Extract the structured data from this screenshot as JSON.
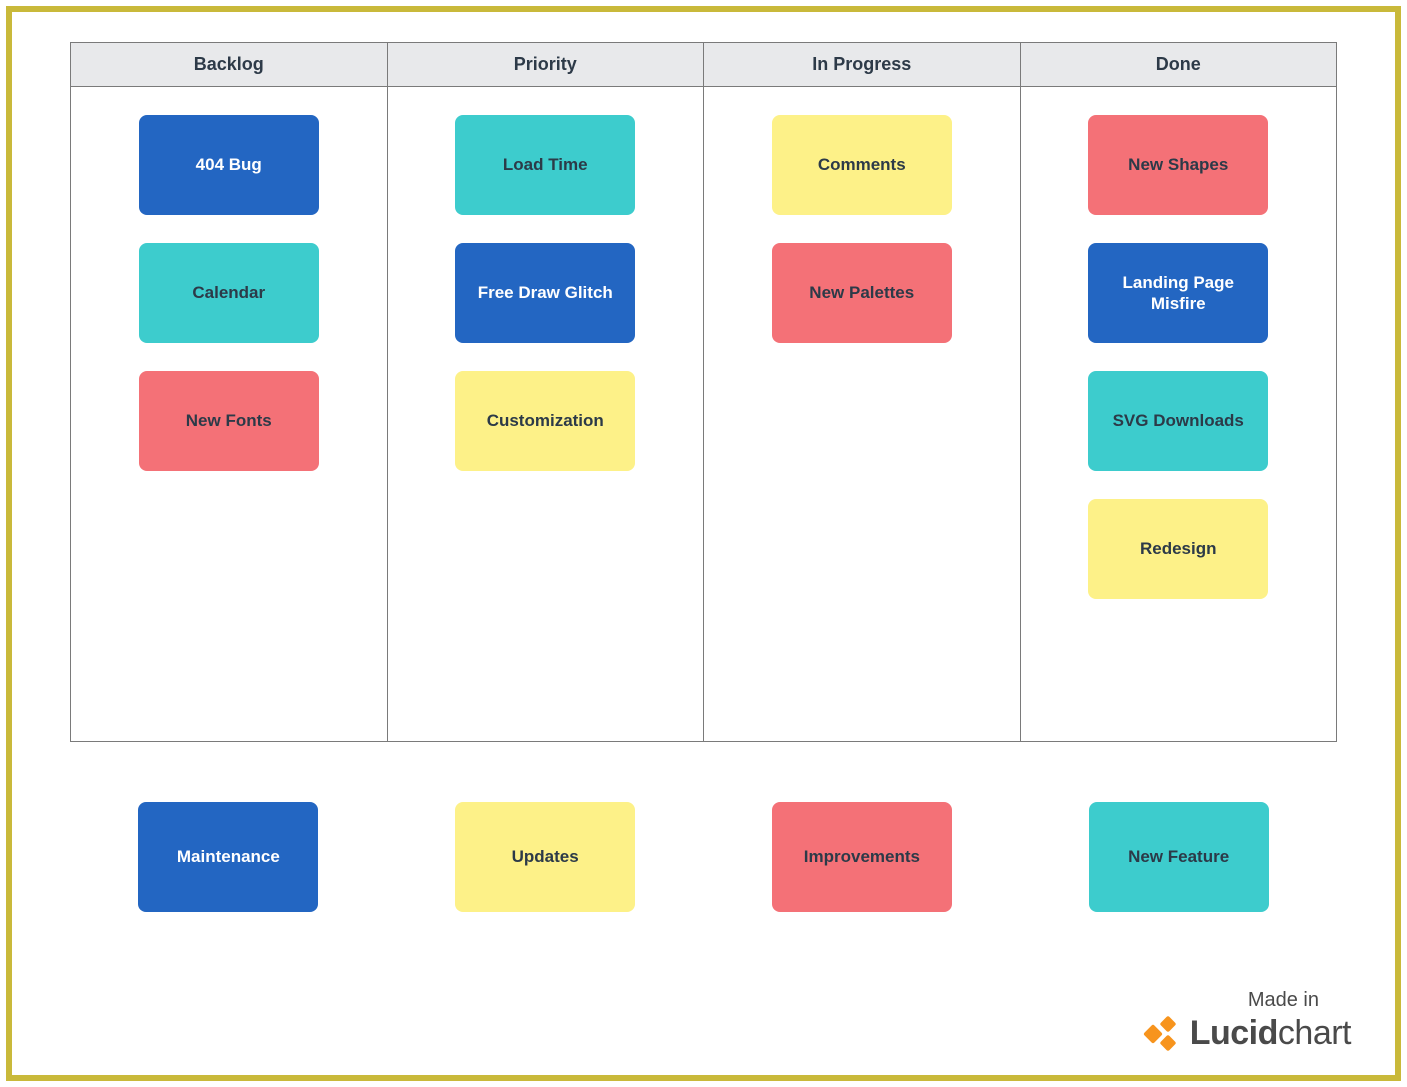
{
  "columns": [
    {
      "title": "Backlog",
      "cards": [
        {
          "label": "404 Bug",
          "color": "blue"
        },
        {
          "label": "Calendar",
          "color": "teal"
        },
        {
          "label": "New Fonts",
          "color": "red"
        }
      ]
    },
    {
      "title": "Priority",
      "cards": [
        {
          "label": "Load Time",
          "color": "teal"
        },
        {
          "label": "Free Draw Glitch",
          "color": "blue"
        },
        {
          "label": "Customization",
          "color": "yellow"
        }
      ]
    },
    {
      "title": "In Progress",
      "cards": [
        {
          "label": "Comments",
          "color": "yellow"
        },
        {
          "label": "New Palettes",
          "color": "red"
        }
      ]
    },
    {
      "title": "Done",
      "cards": [
        {
          "label": "New Shapes",
          "color": "red"
        },
        {
          "label": "Landing Page Misfire",
          "color": "blue"
        },
        {
          "label": "SVG Downloads",
          "color": "teal"
        },
        {
          "label": "Redesign",
          "color": "yellow"
        }
      ]
    }
  ],
  "legend": [
    {
      "label": "Maintenance",
      "color": "blue"
    },
    {
      "label": "Updates",
      "color": "yellow"
    },
    {
      "label": "Improvements",
      "color": "red"
    },
    {
      "label": "New Feature",
      "color": "teal"
    }
  ],
  "branding": {
    "made_in": "Made in",
    "logo_bold": "Lucid",
    "logo_light": "chart"
  }
}
